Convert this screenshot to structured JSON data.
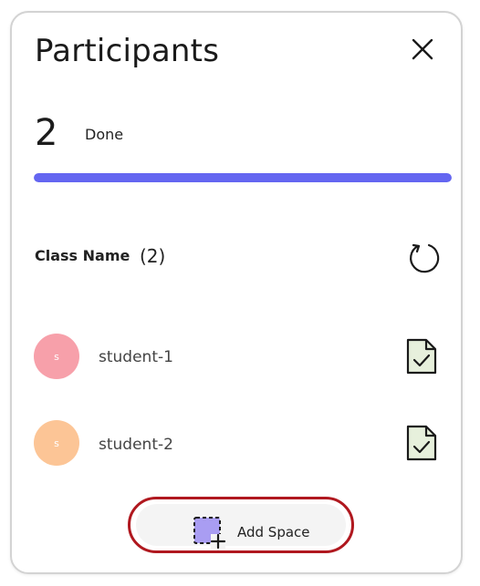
{
  "panel": {
    "title": "Participants",
    "close_icon": "close-icon"
  },
  "status": {
    "count": "2",
    "label": "Done",
    "progress": 1.0,
    "progress_color": "#6466f1"
  },
  "class": {
    "name": "Class Name",
    "count": "(2)",
    "refresh_icon": "refresh-icon"
  },
  "students": [
    {
      "initial": "s",
      "name": "student-1",
      "avatar_color": "#f7a0aa",
      "status_icon": "document-check-icon"
    },
    {
      "initial": "s",
      "name": "student-2",
      "avatar_color": "#fcc596",
      "status_icon": "document-check-icon"
    }
  ],
  "footer": {
    "add_label": "Add Space",
    "add_icon": "add-space-icon",
    "highlight_color": "#b0181f"
  }
}
